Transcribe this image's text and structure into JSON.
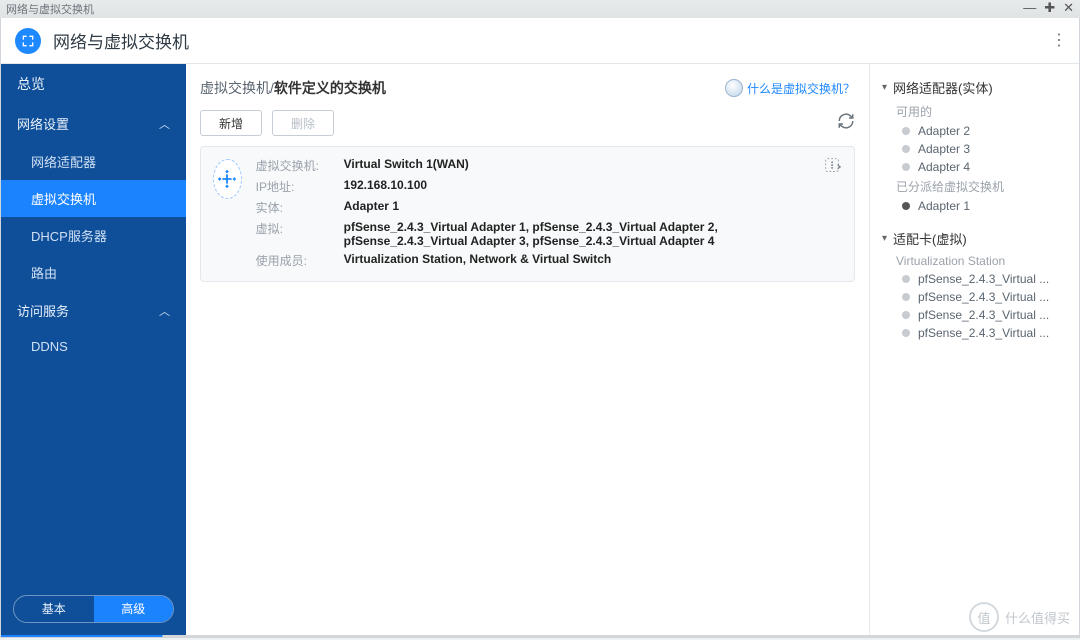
{
  "window": {
    "title": "网络与虚拟交换机"
  },
  "header": {
    "app_title": "网络与虚拟交换机"
  },
  "sidebar": {
    "overview": "总览",
    "group_network": "网络设置",
    "items_network": [
      "网络适配器",
      "虚拟交换机",
      "DHCP服务器",
      "路由"
    ],
    "group_access": "访问服务",
    "items_access": [
      "DDNS"
    ],
    "mode_basic": "基本",
    "mode_advanced": "高级"
  },
  "breadcrumb": {
    "a": "虚拟交换机",
    "sep": " / ",
    "b": "软件定义的交换机"
  },
  "help": {
    "text": "什么是虚拟交换机？"
  },
  "toolbar": {
    "add": "新增",
    "del": "删除"
  },
  "card": {
    "labels": {
      "vswitch": "虚拟交换机:",
      "ip": "IP地址:",
      "physical": "实体:",
      "virtual": "虚拟:",
      "members": "使用成员:"
    },
    "values": {
      "vswitch": "Virtual Switch 1(WAN)",
      "ip": "192.168.10.100",
      "physical": "Adapter 1",
      "virtual": "pfSense_2.4.3_Virtual Adapter 1, pfSense_2.4.3_Virtual Adapter 2, pfSense_2.4.3_Virtual Adapter 3, pfSense_2.4.3_Virtual Adapter 4",
      "members": "Virtualization Station, Network & Virtual Switch"
    }
  },
  "right": {
    "sec1_title": "网络适配器(实体)",
    "sec1_sub_avail": "可用的",
    "sec1_avail": [
      "Adapter 2",
      "Adapter 3",
      "Adapter 4"
    ],
    "sec1_sub_assigned": "已分派给虚拟交换机",
    "sec1_assigned": [
      "Adapter 1"
    ],
    "sec2_title": "适配卡(虚拟)",
    "sec2_sub": "Virtualization Station",
    "sec2_items": [
      "pfSense_2.4.3_Virtual ...",
      "pfSense_2.4.3_Virtual ...",
      "pfSense_2.4.3_Virtual ...",
      "pfSense_2.4.3_Virtual ..."
    ]
  },
  "watermark": {
    "badge": "值",
    "text": "什么值得买"
  }
}
